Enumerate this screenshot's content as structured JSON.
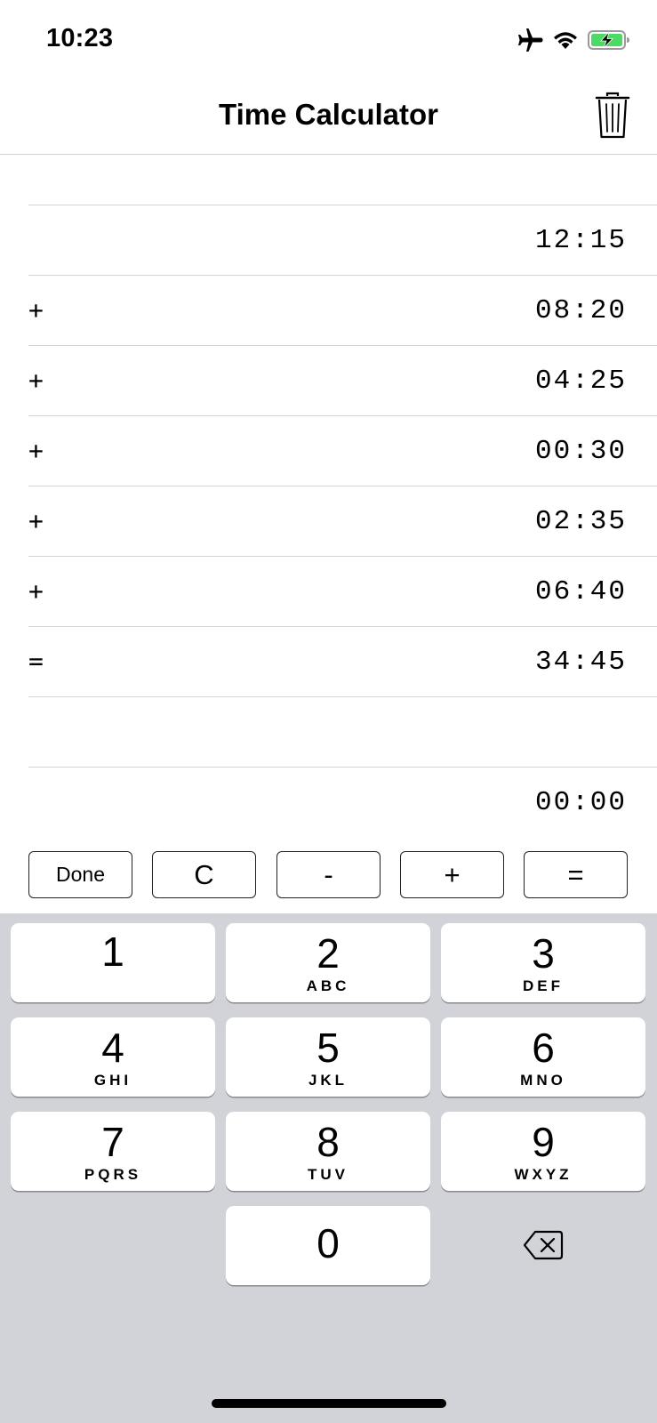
{
  "status_bar": {
    "time": "10:23",
    "icons": [
      "airplane-icon",
      "wifi-icon",
      "battery-charging-icon"
    ]
  },
  "nav": {
    "title": "Time Calculator",
    "trash_icon": "trash-icon"
  },
  "rows": [
    {
      "op": "",
      "value": ""
    },
    {
      "op": "",
      "value": "12:15"
    },
    {
      "op": "+",
      "value": "08:20"
    },
    {
      "op": "+",
      "value": "04:25"
    },
    {
      "op": "+",
      "value": "00:30"
    },
    {
      "op": "+",
      "value": "02:35"
    },
    {
      "op": "+",
      "value": "06:40"
    },
    {
      "op": "=",
      "value": "34:45"
    },
    {
      "op": "",
      "value": ""
    },
    {
      "op": "",
      "value": "00:00"
    }
  ],
  "toolbar": {
    "done": "Done",
    "clear": "C",
    "minus": "-",
    "plus": "+",
    "equals": "="
  },
  "keypad": {
    "keys": [
      {
        "num": "1",
        "letters": ""
      },
      {
        "num": "2",
        "letters": "ABC"
      },
      {
        "num": "3",
        "letters": "DEF"
      },
      {
        "num": "4",
        "letters": "GHI"
      },
      {
        "num": "5",
        "letters": "JKL"
      },
      {
        "num": "6",
        "letters": "MNO"
      },
      {
        "num": "7",
        "letters": "PQRS"
      },
      {
        "num": "8",
        "letters": "TUV"
      },
      {
        "num": "9",
        "letters": "WXYZ"
      },
      {
        "num": "0",
        "letters": ""
      }
    ],
    "backspace_icon": "backspace-icon"
  },
  "colors": {
    "keypad_bg": "#d1d3d9",
    "battery_green": "#4cd964",
    "divider": "#d4d4d6"
  }
}
